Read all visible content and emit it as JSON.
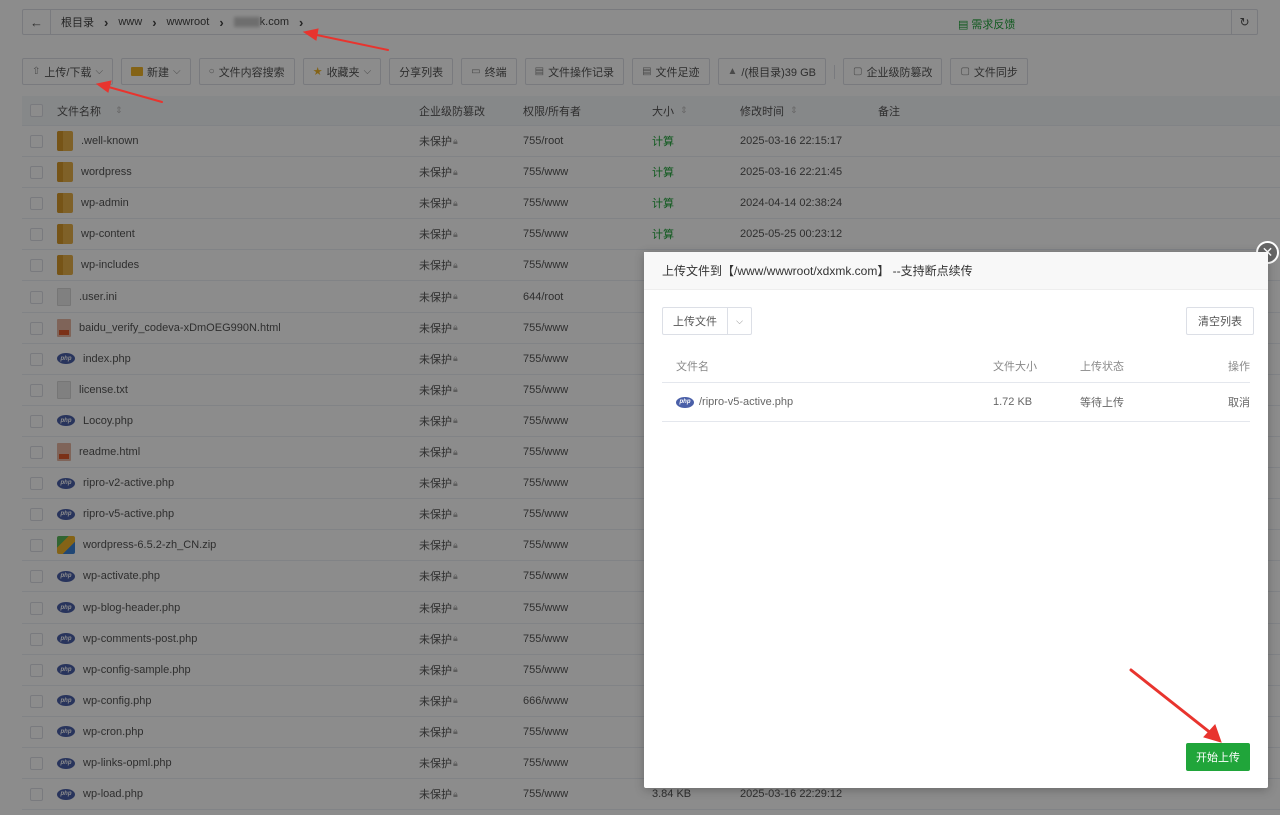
{
  "breadcrumb": {
    "items": [
      "根目录",
      "www",
      "wwwroot",
      "k.com"
    ],
    "feedback": "需求反馈"
  },
  "toolbar": {
    "upload_download": "上传/下载",
    "new": "新建",
    "content_search": "文件内容搜索",
    "favorites": "收藏夹",
    "share_list": "分享列表",
    "terminal": "终端",
    "op_log": "文件操作记录",
    "footprint": "文件足迹",
    "disk": "/(根目录)39 GB",
    "tamper": "企业级防篡改",
    "sync": "文件同步"
  },
  "table": {
    "headers": {
      "name": "文件名称",
      "tamper": "企业级防篡改",
      "perm": "权限/所有者",
      "size": "大小",
      "time": "修改时间",
      "note": "备注"
    },
    "rows": [
      {
        "icon": "folder",
        "name": ".well-known",
        "tamper": "未保护",
        "perm": "755/root",
        "size": "计算",
        "time": "2025-03-16 22:15:17"
      },
      {
        "icon": "folder",
        "name": "wordpress",
        "tamper": "未保护",
        "perm": "755/www",
        "size": "计算",
        "time": "2025-03-16 22:21:45"
      },
      {
        "icon": "folder",
        "name": "wp-admin",
        "tamper": "未保护",
        "perm": "755/www",
        "size": "计算",
        "time": "2024-04-14 02:38:24"
      },
      {
        "icon": "folder",
        "name": "wp-content",
        "tamper": "未保护",
        "perm": "755/www",
        "size": "计算",
        "time": "2025-05-25 00:23:12"
      },
      {
        "icon": "folder",
        "name": "wp-includes",
        "tamper": "未保护",
        "perm": "755/www",
        "size": "",
        "time": ""
      },
      {
        "icon": "file",
        "name": ".user.ini",
        "tamper": "未保护",
        "perm": "644/root",
        "size": "",
        "time": ""
      },
      {
        "icon": "html",
        "name": "baidu_verify_codeva-xDmOEG990N.html",
        "tamper": "未保护",
        "perm": "755/www",
        "size": "",
        "time": ""
      },
      {
        "icon": "php",
        "name": "index.php",
        "tamper": "未保护",
        "perm": "755/www",
        "size": "",
        "time": ""
      },
      {
        "icon": "file",
        "name": "license.txt",
        "tamper": "未保护",
        "perm": "755/www",
        "size": "",
        "time": ""
      },
      {
        "icon": "php",
        "name": "Locoy.php",
        "tamper": "未保护",
        "perm": "755/www",
        "size": "",
        "time": ""
      },
      {
        "icon": "html",
        "name": "readme.html",
        "tamper": "未保护",
        "perm": "755/www",
        "size": "",
        "time": ""
      },
      {
        "icon": "php",
        "name": "ripro-v2-active.php",
        "tamper": "未保护",
        "perm": "755/www",
        "size": "",
        "time": ""
      },
      {
        "icon": "php",
        "name": "ripro-v5-active.php",
        "tamper": "未保护",
        "perm": "755/www",
        "size": "",
        "time": ""
      },
      {
        "icon": "zip",
        "name": "wordpress-6.5.2-zh_CN.zip",
        "tamper": "未保护",
        "perm": "755/www",
        "size": "",
        "time": ""
      },
      {
        "icon": "php",
        "name": "wp-activate.php",
        "tamper": "未保护",
        "perm": "755/www",
        "size": "",
        "time": ""
      },
      {
        "icon": "php",
        "name": "wp-blog-header.php",
        "tamper": "未保护",
        "perm": "755/www",
        "size": "",
        "time": ""
      },
      {
        "icon": "php",
        "name": "wp-comments-post.php",
        "tamper": "未保护",
        "perm": "755/www",
        "size": "",
        "time": ""
      },
      {
        "icon": "php",
        "name": "wp-config-sample.php",
        "tamper": "未保护",
        "perm": "755/www",
        "size": "",
        "time": ""
      },
      {
        "icon": "php",
        "name": "wp-config.php",
        "tamper": "未保护",
        "perm": "666/www",
        "size": "",
        "time": ""
      },
      {
        "icon": "php",
        "name": "wp-cron.php",
        "tamper": "未保护",
        "perm": "755/www",
        "size": "",
        "time": ""
      },
      {
        "icon": "php",
        "name": "wp-links-opml.php",
        "tamper": "未保护",
        "perm": "755/www",
        "size": "",
        "time": ""
      },
      {
        "icon": "php",
        "name": "wp-load.php",
        "tamper": "未保护",
        "perm": "755/www",
        "size": "3.84 KB",
        "time": "2025-03-16 22:29:12"
      }
    ]
  },
  "modal": {
    "title": "上传文件到【/www/wwwroot/xdxmk.com】 --支持断点续传",
    "upload_button": "上传文件",
    "clear_button": "清空列表",
    "headers": {
      "name": "文件名",
      "size": "文件大小",
      "status": "上传状态",
      "op": "操作"
    },
    "file": {
      "name": "/ripro-v5-active.php",
      "size": "1.72 KB",
      "status": "等待上传",
      "op": "取消"
    },
    "start_button": "开始上传"
  },
  "colors": {
    "accent": "#20a53a",
    "annotation_arrow": "#e8342e"
  }
}
